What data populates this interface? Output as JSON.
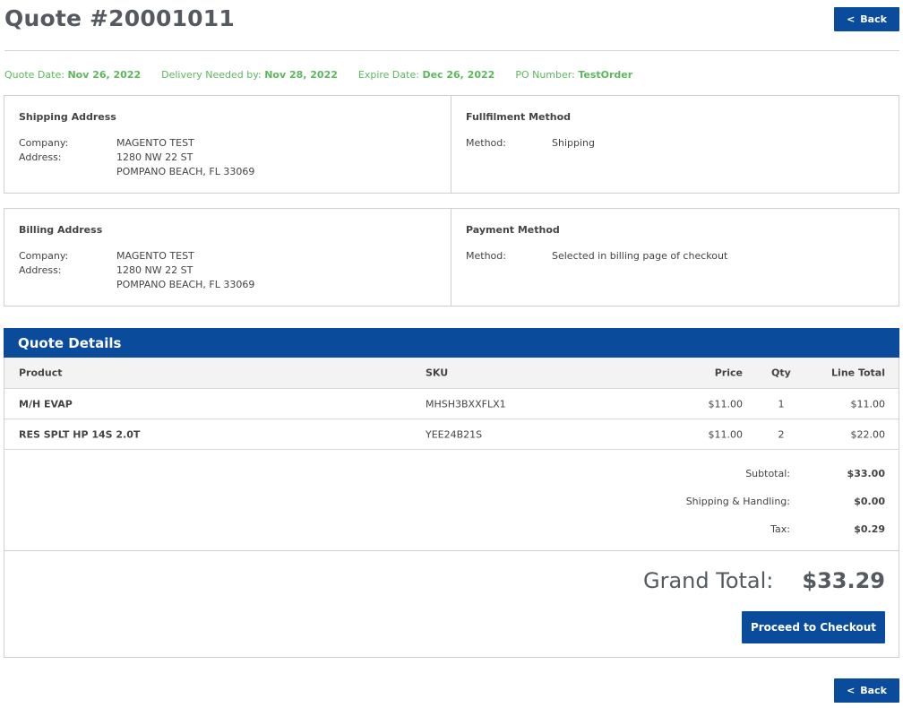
{
  "page": {
    "title": "Quote #20001011"
  },
  "nav": {
    "back_label": "Back",
    "back_icon": "<"
  },
  "meta": {
    "quote_date_label": "Quote Date:",
    "quote_date": "Nov 26, 2022",
    "delivery_label": "Delivery Needed by:",
    "delivery": "Nov 28, 2022",
    "expire_label": "Expire Date:",
    "expire": "Dec 26, 2022",
    "po_label": "PO Number:",
    "po": "TestOrder"
  },
  "shipping": {
    "heading": "Shipping Address",
    "company_label": "Company:",
    "company": "MAGENTO TEST",
    "address_label": "Address:",
    "address_line1": "1280 NW 22 ST",
    "address_line2": "POMPANO BEACH, FL 33069"
  },
  "fulfillment": {
    "heading": "Fullfilment Method",
    "method_label": "Method:",
    "method": "Shipping"
  },
  "billing": {
    "heading": "Billing Address",
    "company_label": "Company:",
    "company": "MAGENTO TEST",
    "address_label": "Address:",
    "address_line1": "1280 NW 22 ST",
    "address_line2": "POMPANO BEACH, FL 33069"
  },
  "payment": {
    "heading": "Payment Method",
    "method_label": "Method:",
    "method": "Selected in billing page of checkout"
  },
  "details": {
    "heading": "Quote Details",
    "columns": {
      "product": "Product",
      "sku": "SKU",
      "price": "Price",
      "qty": "Qty",
      "line_total": "Line Total"
    },
    "items": [
      {
        "product": "M/H EVAP",
        "sku": "MHSH3BXXFLX1",
        "price": "$11.00",
        "qty": "1",
        "line_total": "$11.00"
      },
      {
        "product": "RES SPLT HP 14S 2.0T",
        "sku": "YEE24B21S",
        "price": "$11.00",
        "qty": "2",
        "line_total": "$22.00"
      }
    ]
  },
  "totals": {
    "subtotal_label": "Subtotal:",
    "subtotal": "$33.00",
    "shipping_label": "Shipping & Handling:",
    "shipping": "$0.00",
    "tax_label": "Tax:",
    "tax": "$0.29",
    "grand_label": "Grand Total:",
    "grand": "$33.29"
  },
  "actions": {
    "checkout_label": "Proceed to Checkout"
  },
  "colors": {
    "brand": "#0a4b9c",
    "meta_green": "#5cb85c"
  }
}
